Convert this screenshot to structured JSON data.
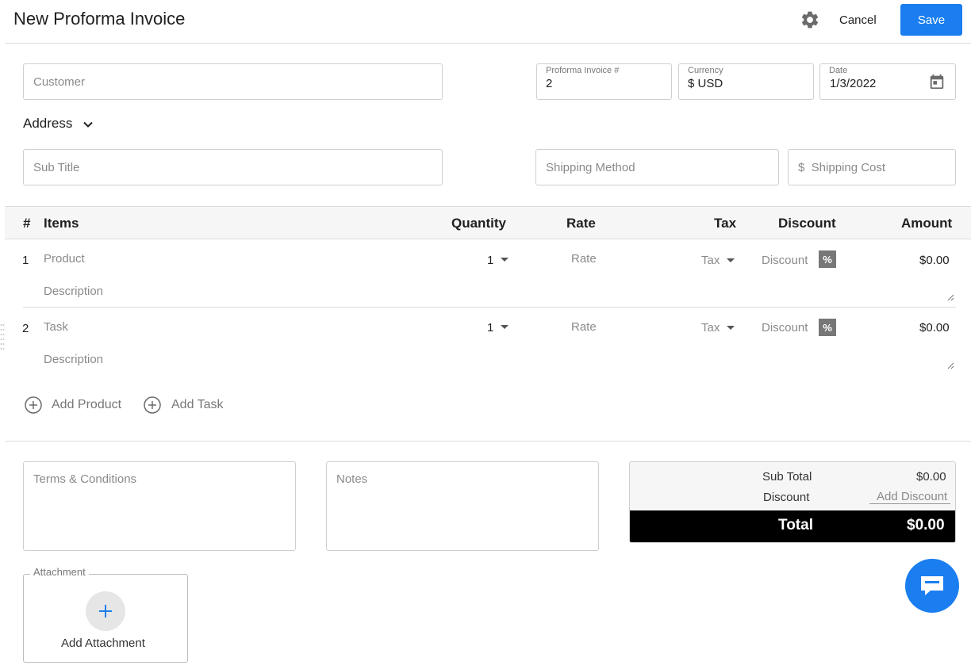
{
  "header": {
    "title": "New Proforma Invoice",
    "cancel_label": "Cancel",
    "save_label": "Save",
    "settings_icon": "gear-icon"
  },
  "form": {
    "customer_placeholder": "Customer",
    "invoice_number_label": "Proforma Invoice #",
    "invoice_number_value": "2",
    "currency_label": "Currency",
    "currency_value": "$ USD",
    "date_label": "Date",
    "date_value": "1/3/2022",
    "address_label": "Address",
    "subtitle_placeholder": "Sub Title",
    "shipping_method_placeholder": "Shipping Method",
    "shipping_cost_placeholder": "$  Shipping Cost"
  },
  "table": {
    "headers": {
      "num": "#",
      "items": "Items",
      "quantity": "Quantity",
      "rate": "Rate",
      "tax": "Tax",
      "discount": "Discount",
      "amount": "Amount"
    },
    "rows": [
      {
        "num": "1",
        "item": "Product",
        "description": "Description",
        "quantity": "1",
        "rate": "Rate",
        "tax": "Tax",
        "discount": "Discount",
        "discount_type": "%",
        "amount": "$0.00"
      },
      {
        "num": "2",
        "item": "Task",
        "description": "Description",
        "quantity": "1",
        "rate": "Rate",
        "tax": "Tax",
        "discount": "Discount",
        "discount_type": "%",
        "amount": "$0.00"
      }
    ],
    "add_product_label": "Add Product",
    "add_task_label": "Add Task"
  },
  "footer": {
    "terms_placeholder": "Terms & Conditions",
    "notes_placeholder": "Notes",
    "subtotal_label": "Sub Total",
    "subtotal_value": "$0.00",
    "discount_label": "Discount",
    "add_discount_label": "Add Discount",
    "total_label": "Total",
    "total_value": "$0.00",
    "attachment_label": "Attachment",
    "add_attachment_label": "Add Attachment"
  },
  "colors": {
    "accent": "#1a7ef0",
    "total_bar": "#000000",
    "border": "#cfcfcf"
  }
}
